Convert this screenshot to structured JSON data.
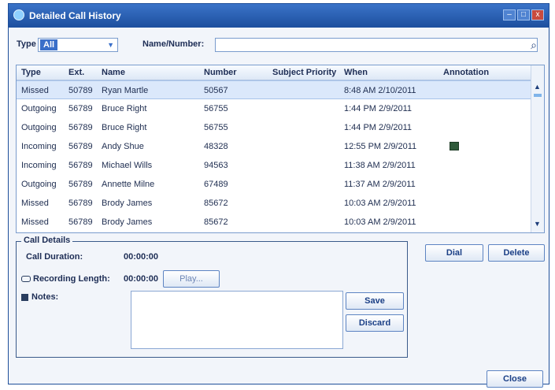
{
  "window": {
    "title": "Detailed Call History",
    "buttons": [
      "–",
      "□",
      "x"
    ]
  },
  "filters": {
    "type_label": "Type",
    "type_value": "All",
    "name_label": "Name/Number:",
    "name_value": "",
    "search_icon": "search-icon"
  },
  "table": {
    "headers": [
      "Type",
      "Ext.",
      "Name",
      "Number",
      "Subject Priority",
      "When",
      "Annotation"
    ],
    "rows": [
      {
        "type": "Missed",
        "ext": "50789",
        "name": "Ryan Martle",
        "number": "50567",
        "when": "8:48 AM 2/10/2011",
        "annotation": "",
        "selected": true
      },
      {
        "type": "Outgoing",
        "ext": "56789",
        "name": "Bruce Right",
        "number": "56755",
        "when": "1:44 PM 2/9/2011",
        "annotation": ""
      },
      {
        "type": "Outgoing",
        "ext": "56789",
        "name": "Bruce Right",
        "number": "56755",
        "when": "1:44 PM 2/9/2011",
        "annotation": ""
      },
      {
        "type": "Incoming",
        "ext": "56789",
        "name": "Andy Shue",
        "number": "48328",
        "when": "12:55 PM 2/9/2011",
        "annotation": "note-icon"
      },
      {
        "type": "Incoming",
        "ext": "56789",
        "name": "Michael Wills",
        "number": "94563",
        "when": "11:38 AM 2/9/2011",
        "annotation": ""
      },
      {
        "type": "Outgoing",
        "ext": "56789",
        "name": "Annette Milne",
        "number": "67489",
        "when": "11:37 AM 2/9/2011",
        "annotation": ""
      },
      {
        "type": "Missed",
        "ext": "56789",
        "name": "Brody James",
        "number": "85672",
        "when": "10:03 AM 2/9/2011",
        "annotation": ""
      },
      {
        "type": "Missed",
        "ext": "56789",
        "name": "Brody James",
        "number": "85672",
        "when": "10:03 AM 2/9/2011",
        "annotation": ""
      }
    ]
  },
  "details": {
    "legend": "Call Details",
    "duration_label": "Call Duration:",
    "duration_value": "00:00:00",
    "recording_label": "Recording Length:",
    "recording_value": "00:00:00",
    "play_label": "Play...",
    "notes_label": "Notes:"
  },
  "buttons": {
    "dial": "Dial",
    "delete": "Delete",
    "save": "Save",
    "discard": "Discard",
    "close": "Close"
  }
}
